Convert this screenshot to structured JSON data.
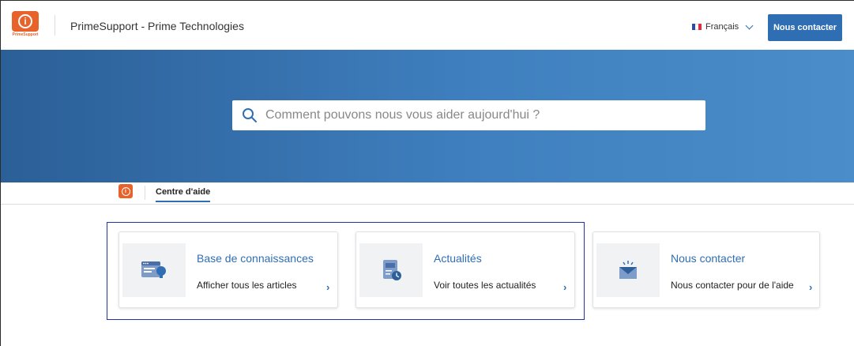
{
  "header": {
    "logo_text": "PrimeSupport",
    "site_title": "PrimeSupport - Prime Technologies",
    "language": "Français",
    "contact_button": "Nous contacter"
  },
  "hero": {
    "search_placeholder": "Comment pouvons nous vous aider aujourd'hui ?"
  },
  "nav": {
    "tab_label": "Centre d'aide"
  },
  "cards": [
    {
      "title": "Base de connaissances",
      "subtitle": "Afficher tous les articles",
      "icon": "knowledge-base-icon"
    },
    {
      "title": "Actualités",
      "subtitle": "Voir toutes les actualités",
      "icon": "news-icon"
    },
    {
      "title": "Nous contacter",
      "subtitle": "Nous contacter pour de l'aide",
      "icon": "envelope-icon"
    }
  ],
  "colors": {
    "accent": "#2f6eb3",
    "brand_orange": "#e8622b",
    "hero_start": "#2b5f97",
    "hero_end": "#4a8dca"
  }
}
